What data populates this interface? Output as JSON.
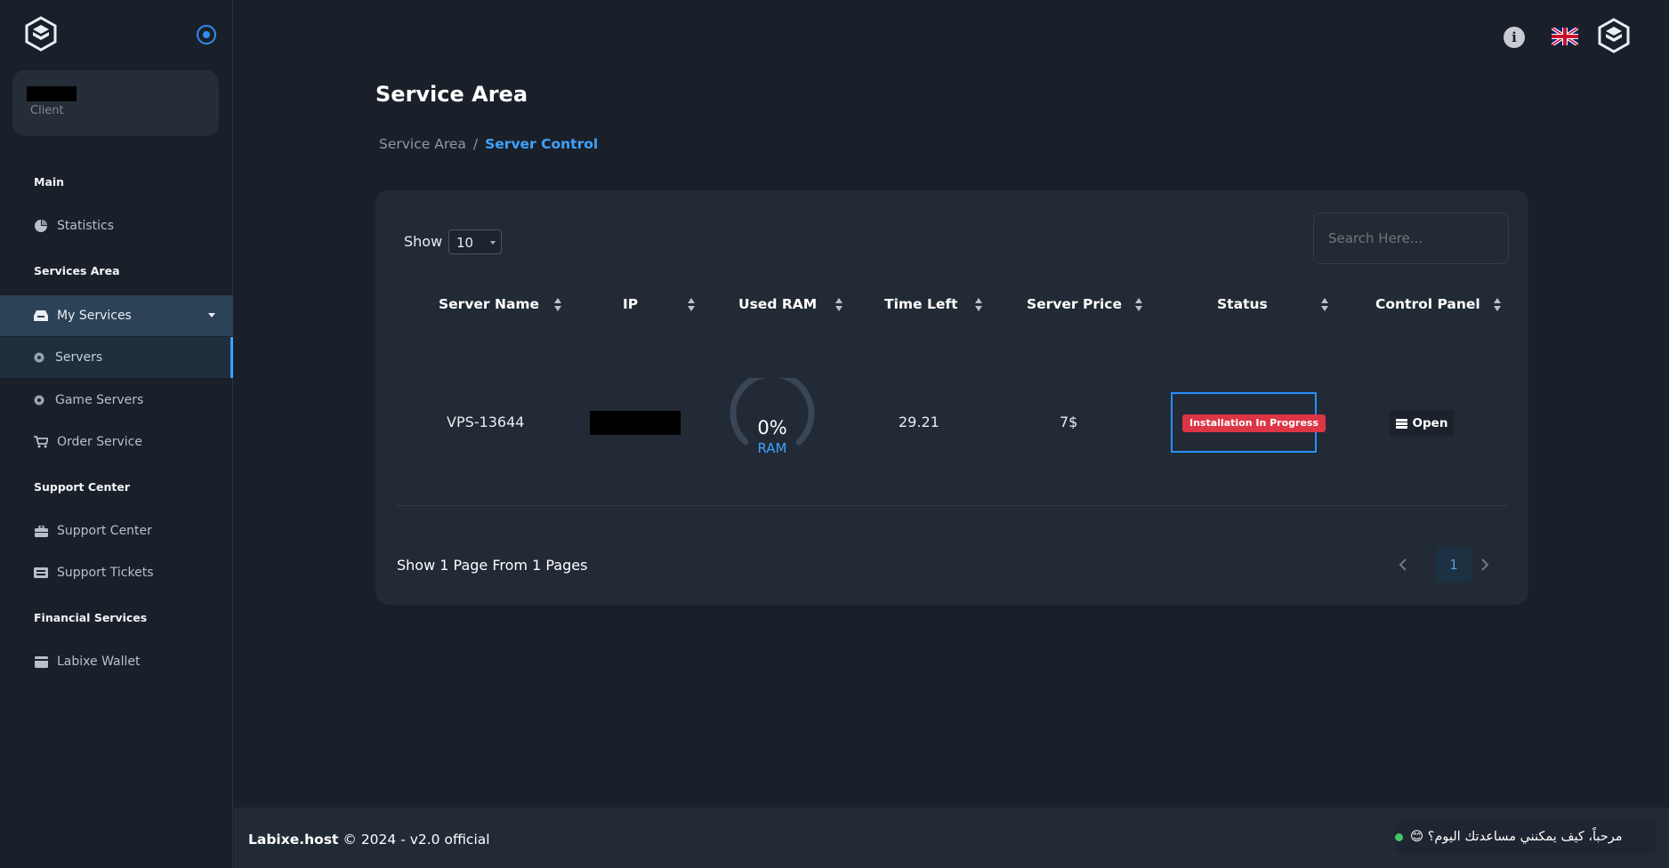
{
  "sidebar": {
    "user": {
      "role": "Client"
    },
    "sections": {
      "main": "Main",
      "services_area": "Services Area",
      "support_center": "Support Center",
      "financial_services": "Financial Services"
    },
    "items": {
      "statistics": "Statistics",
      "my_services": "My Services",
      "servers": "Servers",
      "game_servers": "Game Servers",
      "order_service": "Order Service",
      "support_center": "Support Center",
      "support_tickets": "Support Tickets",
      "wallet": "Labixe Wallet"
    }
  },
  "header": {
    "page_title": "Service Area",
    "breadcrumb": {
      "parent": "Service Area",
      "separator": "/",
      "current": "Server Control"
    }
  },
  "table_controls": {
    "show_label": "Show :",
    "page_size": "10",
    "search_placeholder": "Search Here..."
  },
  "table": {
    "columns": [
      "Server Name",
      "IP",
      "Used RAM",
      "Time Left",
      "Server Price",
      "Status",
      "Control Panel"
    ],
    "rows": [
      {
        "server_name": "VPS-13644",
        "used_ram_percent": "0%",
        "used_ram_label": "RAM",
        "time_left": "29.21",
        "price": "7$",
        "status": "Installation In Progress",
        "control_label": "Open"
      }
    ]
  },
  "pagination": {
    "info": "Show 1 Page From 1 Pages",
    "current_page": "1"
  },
  "footer": {
    "brand": "Labixe.host",
    "text": " © 2024 - v2.0 official"
  },
  "chat": {
    "greeting": "مرحباً، كيف يمكنني مساعدتك اليوم؟ 😊"
  },
  "colors": {
    "accent": "#3fa2ff",
    "status_danger": "#dc3545",
    "online": "#3fc76a"
  }
}
